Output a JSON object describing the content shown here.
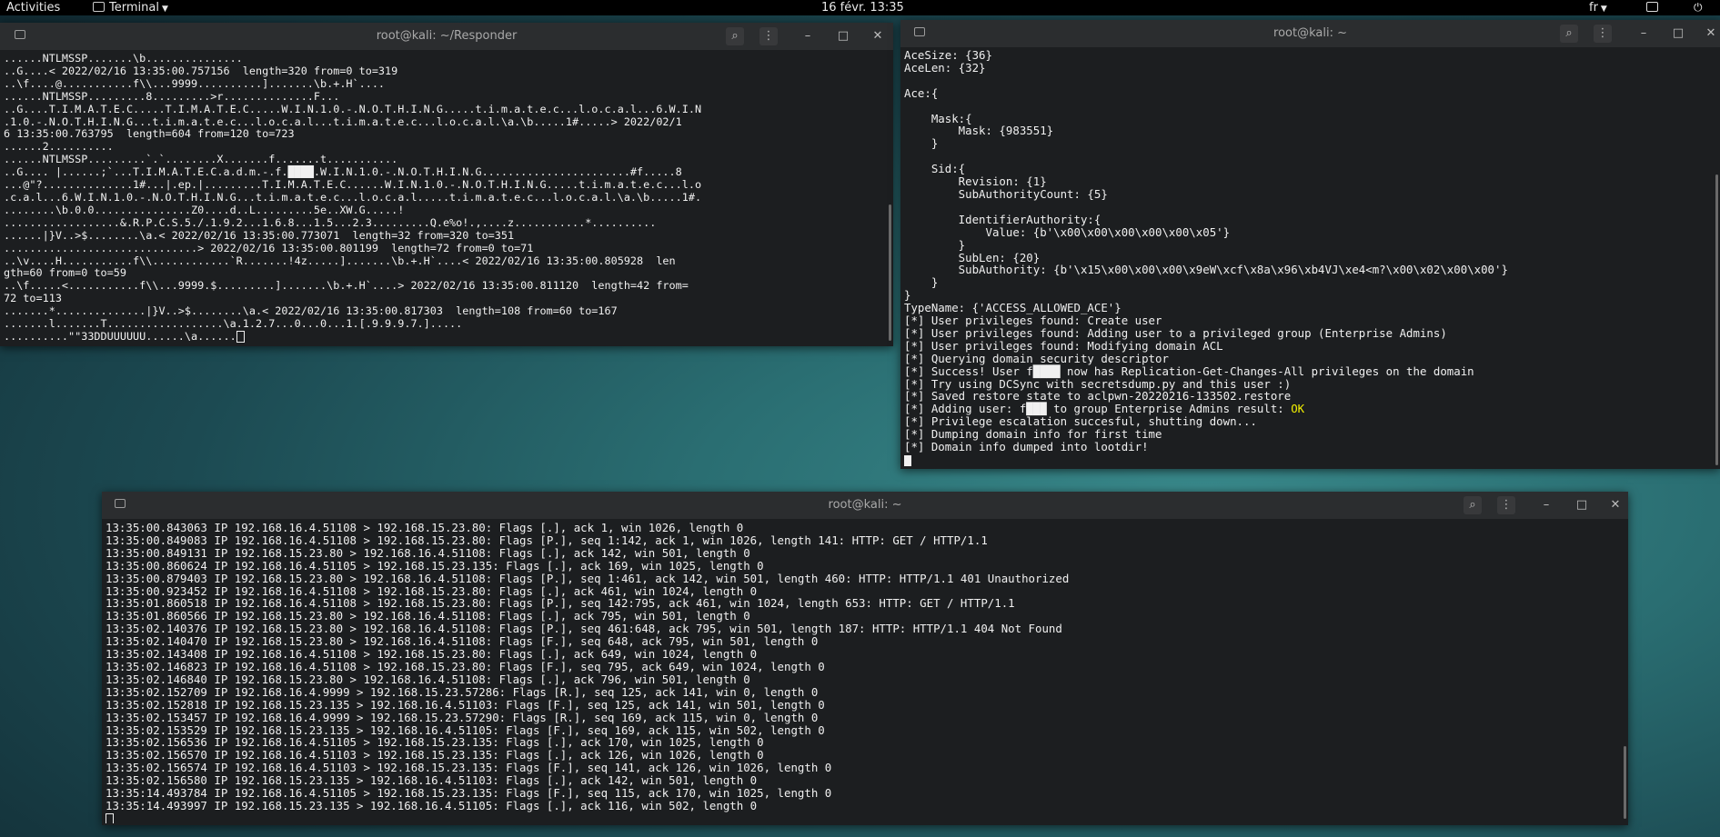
{
  "topbar": {
    "activities": "Activities",
    "app_name": "Terminal",
    "clock": "16 févr. 13:35",
    "lang": "fr"
  },
  "windows": {
    "responder": {
      "title": "root@kali: ~/Responder",
      "lines": [
        "......NTLMSSP.......\\b...............",
        "..G....< 2022/02/16 13:35:00.757156  length=320 from=0 to=319",
        "..\\f....@...........f\\\\...9999..........].......\\b.+.H`....",
        "......NTLMSSP.........8.........>r..............F...",
        "..G....T.I.M.A.T.E.C.....T.I.M.A.T.E.C.....W.I.N.1.0.-.N.O.T.H.I.N.G.....t.i.m.a.t.e.c...l.o.c.a.l...6.W.I.N",
        ".1.0.-.N.O.T.H.I.N.G...t.i.m.a.t.e.c...l.o.c.a.l...t.i.m.a.t.e.c...l.o.c.a.l.\\a.\\b.....1#.....> 2022/02/1",
        "6 13:35:00.763795  length=604 from=120 to=723",
        "......2..........",
        "......NTLMSSP.........`.`........X.......f.......t...........",
        "..G.... |......;`...T.I.M.A.T.E.C.a.d.m.-.f.████.W.I.N.1.0.-.N.O.T.H.I.N.G.......................#f.....8",
        "...@\"?..............1#...|.ep.|.........T.I.M.A.T.E.C......W.I.N.1.0.-.N.O.T.H.I.N.G.....t.i.m.a.t.e.c...l.o",
        ".c.a.l...6.W.I.N.1.0.-.N.O.T.H.I.N.G...t.i.m.a.t.e.c...l.o.c.a.l.....t.i.m.a.t.e.c...l.o.c.a.l.\\a.\\b.....1#.",
        "........\\b.0.0...............Z0....d..L.........5e..XW.G.....!",
        "..................&.R.P.C.S.5./.1.9.2...1.6.8...1.5...2.3.........Q.e%o!.,....z...........*..........",
        "......|}V..>$........\\a.< 2022/02/16 13:35:00.773071  length=32 from=320 to=351",
        "..............................> 2022/02/16 13:35:00.801199  length=72 from=0 to=71",
        "..\\v....H...........f\\\\............`R.......!4z.....].......\\b.+.H`....< 2022/02/16 13:35:00.805928  len",
        "gth=60 from=0 to=59",
        "..\\f.....<...........f\\\\...9999.$.........].......\\b.+.H`....> 2022/02/16 13:35:00.811120  length=42 from=",
        "72 to=113",
        ".......*..............|}V..>$........\\a.< 2022/02/16 13:35:00.817303  length=108 from=60 to=167",
        ".......l.......T..................\\a.1.2.7...0...0...1.[.9.9.9.7.].....",
        "..........\"\"33DDUUUUUU......\\a......"
      ]
    },
    "aclpwn": {
      "title": "root@kali: ~",
      "lines": [
        "AceSize: {36}",
        "AceLen: {32}",
        "",
        "Ace:{",
        "",
        "    Mask:{",
        "        Mask: {983551}",
        "    }",
        "",
        "    Sid:{",
        "        Revision: {1}",
        "        SubAuthorityCount: {5}",
        "",
        "        IdentifierAuthority:{",
        "            Value: {b'\\x00\\x00\\x00\\x00\\x00\\x05'}",
        "        }",
        "        SubLen: {20}",
        "        SubAuthority: {b'\\x15\\x00\\x00\\x00\\x9eW\\xcf\\x8a\\x96\\xb4VJ\\xe4<m?\\x00\\x02\\x00\\x00'}",
        "    }",
        "}",
        "TypeName: {'ACCESS_ALLOWED_ACE'}",
        "[*] User privileges found: Create user",
        "[*] User privileges found: Adding user to a privileged group (Enterprise Admins)",
        "[*] User privileges found: Modifying domain ACL",
        "[*] Querying domain security descriptor",
        "[*] Success! User f████ now has Replication-Get-Changes-All privileges on the domain",
        "[*] Try using DCSync with secretsdump.py and this user :)",
        "[*] Saved restore state to aclpwn-20220216-133502.restore",
        "[*] Adding user: f███ to group Enterprise Admins result: ",
        "[*] Privilege escalation succesful, shutting down...",
        "[*] Dumping domain info for first time",
        "[*] Domain info dumped into lootdir!"
      ],
      "ok_text": "OK"
    },
    "tcpdump": {
      "title": "root@kali: ~",
      "lines": [
        "13:35:00.843063 IP 192.168.16.4.51108 > 192.168.15.23.80: Flags [.], ack 1, win 1026, length 0",
        "13:35:00.849083 IP 192.168.16.4.51108 > 192.168.15.23.80: Flags [P.], seq 1:142, ack 1, win 1026, length 141: HTTP: GET / HTTP/1.1",
        "13:35:00.849131 IP 192.168.15.23.80 > 192.168.16.4.51108: Flags [.], ack 142, win 501, length 0",
        "13:35:00.860624 IP 192.168.16.4.51105 > 192.168.15.23.135: Flags [.], ack 169, win 1025, length 0",
        "13:35:00.879403 IP 192.168.15.23.80 > 192.168.16.4.51108: Flags [P.], seq 1:461, ack 142, win 501, length 460: HTTP: HTTP/1.1 401 Unauthorized",
        "13:35:00.923452 IP 192.168.16.4.51108 > 192.168.15.23.80: Flags [.], ack 461, win 1024, length 0",
        "13:35:01.860518 IP 192.168.16.4.51108 > 192.168.15.23.80: Flags [P.], seq 142:795, ack 461, win 1024, length 653: HTTP: GET / HTTP/1.1",
        "13:35:01.860566 IP 192.168.15.23.80 > 192.168.16.4.51108: Flags [.], ack 795, win 501, length 0",
        "13:35:02.140376 IP 192.168.15.23.80 > 192.168.16.4.51108: Flags [P.], seq 461:648, ack 795, win 501, length 187: HTTP: HTTP/1.1 404 Not Found",
        "13:35:02.140470 IP 192.168.15.23.80 > 192.168.16.4.51108: Flags [F.], seq 648, ack 795, win 501, length 0",
        "13:35:02.143408 IP 192.168.16.4.51108 > 192.168.15.23.80: Flags [.], ack 649, win 1024, length 0",
        "13:35:02.146823 IP 192.168.16.4.51108 > 192.168.15.23.80: Flags [F.], seq 795, ack 649, win 1024, length 0",
        "13:35:02.146840 IP 192.168.15.23.80 > 192.168.16.4.51108: Flags [.], ack 796, win 501, length 0",
        "13:35:02.152709 IP 192.168.16.4.9999 > 192.168.15.23.57286: Flags [R.], seq 125, ack 141, win 0, length 0",
        "13:35:02.152818 IP 192.168.15.23.135 > 192.168.16.4.51103: Flags [F.], seq 125, ack 141, win 501, length 0",
        "13:35:02.153457 IP 192.168.16.4.9999 > 192.168.15.23.57290: Flags [R.], seq 169, ack 115, win 0, length 0",
        "13:35:02.153529 IP 192.168.15.23.135 > 192.168.16.4.51105: Flags [F.], seq 169, ack 115, win 502, length 0",
        "13:35:02.156536 IP 192.168.16.4.51105 > 192.168.15.23.135: Flags [.], ack 170, win 1025, length 0",
        "13:35:02.156570 IP 192.168.16.4.51103 > 192.168.15.23.135: Flags [.], ack 126, win 1026, length 0",
        "13:35:02.156574 IP 192.168.16.4.51103 > 192.168.15.23.135: Flags [F.], seq 141, ack 126, win 1026, length 0",
        "13:35:02.156580 IP 192.168.15.23.135 > 192.168.16.4.51103: Flags [.], ack 142, win 501, length 0",
        "13:35:14.493784 IP 192.168.16.4.51105 > 192.168.15.23.135: Flags [F.], seq 115, ack 170, win 1025, length 0",
        "13:35:14.493997 IP 192.168.15.23.135 > 192.168.16.4.51105: Flags [.], ack 116, win 502, length 0"
      ]
    }
  }
}
